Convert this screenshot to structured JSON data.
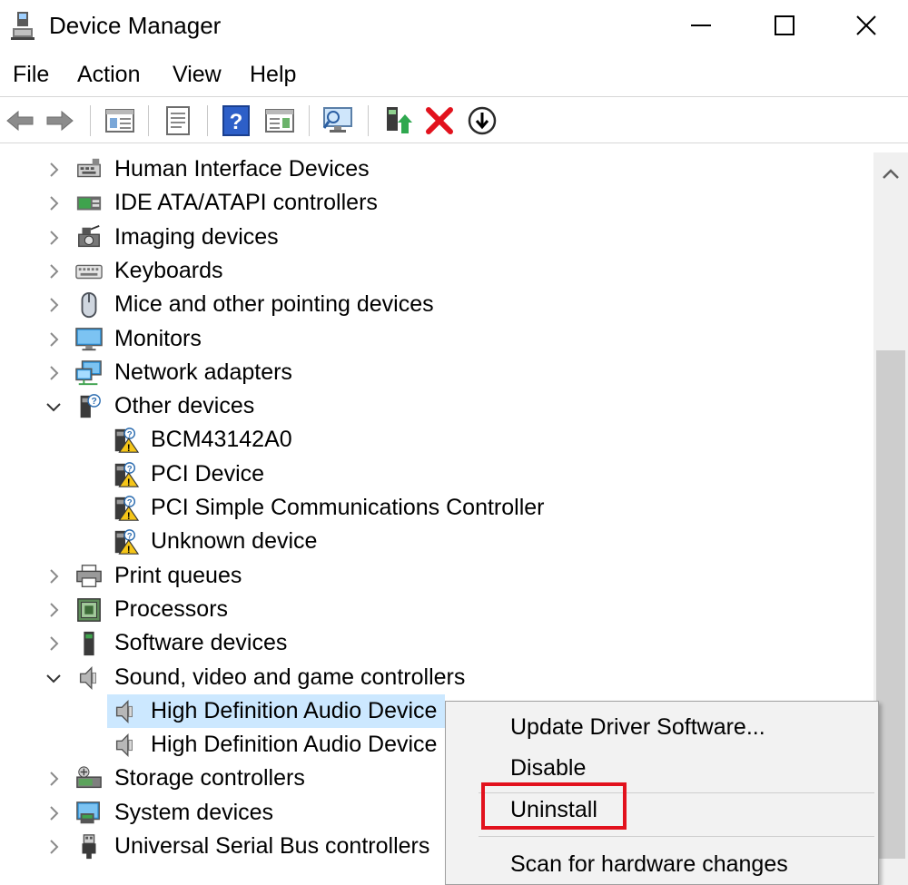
{
  "window": {
    "title": "Device Manager",
    "controls": {
      "minimize": "minimize-icon",
      "maximize": "maximize-icon",
      "close": "close-icon"
    }
  },
  "menu": [
    "File",
    "Action",
    "View",
    "Help"
  ],
  "toolbar": {
    "buttons": [
      "back-arrow-icon",
      "forward-arrow-icon",
      "show-hide-console-tree-icon",
      "properties-icon",
      "help-icon",
      "action-pane-icon",
      "scan-hardware-icon",
      "update-driver-icon",
      "uninstall-x-icon",
      "disable-device-icon"
    ]
  },
  "tree": [
    {
      "label": "Human Interface Devices",
      "expanded": false,
      "level": 0
    },
    {
      "label": "IDE ATA/ATAPI controllers",
      "expanded": false,
      "level": 0
    },
    {
      "label": "Imaging devices",
      "expanded": false,
      "level": 0
    },
    {
      "label": "Keyboards",
      "expanded": false,
      "level": 0
    },
    {
      "label": "Mice and other pointing devices",
      "expanded": false,
      "level": 0
    },
    {
      "label": "Monitors",
      "expanded": false,
      "level": 0
    },
    {
      "label": "Network adapters",
      "expanded": false,
      "level": 0
    },
    {
      "label": "Other devices",
      "expanded": true,
      "level": 0
    },
    {
      "label": "BCM43142A0",
      "level": 1,
      "warning": true
    },
    {
      "label": "PCI Device",
      "level": 1,
      "warning": true
    },
    {
      "label": "PCI Simple Communications Controller",
      "level": 1,
      "warning": true
    },
    {
      "label": "Unknown device",
      "level": 1,
      "warning": true
    },
    {
      "label": "Print queues",
      "expanded": false,
      "level": 0
    },
    {
      "label": "Processors",
      "expanded": false,
      "level": 0
    },
    {
      "label": "Software devices",
      "expanded": false,
      "level": 0
    },
    {
      "label": "Sound, video and game controllers",
      "expanded": true,
      "level": 0
    },
    {
      "label": "High Definition Audio Device",
      "level": 1,
      "selected": true
    },
    {
      "label": "High Definition Audio Device",
      "level": 1
    },
    {
      "label": "Storage controllers",
      "expanded": false,
      "level": 0
    },
    {
      "label": "System devices",
      "expanded": false,
      "level": 0
    },
    {
      "label": "Universal Serial Bus controllers",
      "expanded": false,
      "level": 0
    }
  ],
  "context_menu": {
    "items": [
      "Update Driver Software...",
      "Disable",
      "Uninstall",
      "Scan for hardware changes"
    ],
    "highlighted": "Uninstall"
  },
  "colors": {
    "selection": "#cce8ff",
    "highlight_box": "#e2121d",
    "menu_bg": "#f2f2f2",
    "warning": "#f5c518"
  }
}
